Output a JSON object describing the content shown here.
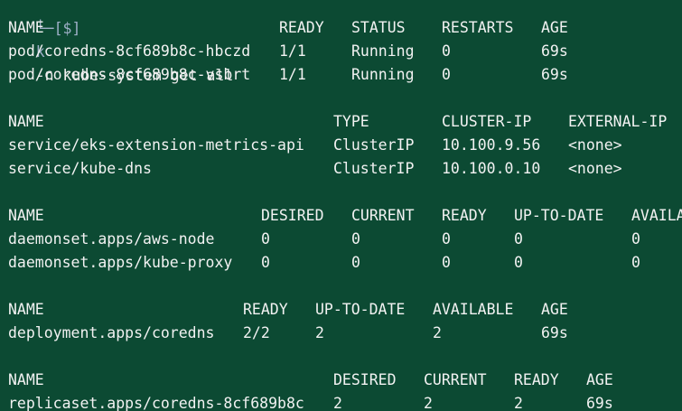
{
  "terminal": {
    "prompt": {
      "corner": "└─[$]",
      "symbol": "k",
      "command": "-n kube-system get all"
    },
    "pods": {
      "headers": [
        "NAME",
        "READY",
        "STATUS",
        "RESTARTS",
        "AGE"
      ],
      "rows": [
        [
          "pod/coredns-8cf689b8c-hbczd",
          "1/1",
          "Running",
          "0",
          "69s"
        ],
        [
          "pod/coredns-8cf689b8c-vsbrt",
          "1/1",
          "Running",
          "0",
          "69s"
        ]
      ]
    },
    "services": {
      "headers": [
        "NAME",
        "TYPE",
        "CLUSTER-IP",
        "EXTERNAL-IP"
      ],
      "rows": [
        [
          "service/eks-extension-metrics-api",
          "ClusterIP",
          "10.100.9.56",
          "<none>"
        ],
        [
          "service/kube-dns",
          "ClusterIP",
          "10.100.0.10",
          "<none>"
        ]
      ]
    },
    "daemonsets": {
      "headers": [
        "NAME",
        "DESIRED",
        "CURRENT",
        "READY",
        "UP-TO-DATE",
        "AVAILA"
      ],
      "rows": [
        [
          "daemonset.apps/aws-node",
          "0",
          "0",
          "0",
          "0",
          "0"
        ],
        [
          "daemonset.apps/kube-proxy",
          "0",
          "0",
          "0",
          "0",
          "0"
        ]
      ]
    },
    "deployments": {
      "headers": [
        "NAME",
        "READY",
        "UP-TO-DATE",
        "AVAILABLE",
        "AGE"
      ],
      "rows": [
        [
          "deployment.apps/coredns",
          "2/2",
          "2",
          "2",
          "69s"
        ]
      ]
    },
    "replicasets": {
      "headers": [
        "NAME",
        "DESIRED",
        "CURRENT",
        "READY",
        "AGE"
      ],
      "rows": [
        [
          "replicaset.apps/coredns-8cf689b8c",
          "2",
          "2",
          "2",
          "69s"
        ]
      ]
    },
    "colors": {
      "background": "#0c4a33",
      "text": "#f2f2f2",
      "prompt": "#9fb0c8"
    }
  }
}
